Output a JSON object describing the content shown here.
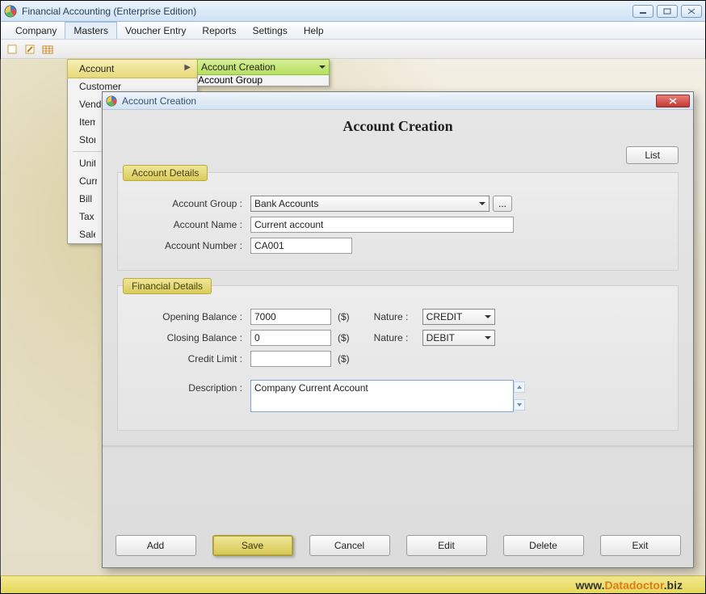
{
  "window": {
    "title": "Financial Accounting (Enterprise Edition)"
  },
  "menubar": {
    "items": [
      "Company",
      "Masters",
      "Voucher Entry",
      "Reports",
      "Settings",
      "Help"
    ],
    "active_index": 1
  },
  "masters_menu": {
    "items": [
      "Account",
      "Customer",
      "Vendor",
      "Item",
      "Store",
      "Unit",
      "Currency",
      "Bill Sundry",
      "Tax",
      "Salesman"
    ],
    "highlight_index": 0
  },
  "account_submenu": {
    "items": [
      "Account Creation",
      "Account Group"
    ],
    "selected_index": 0
  },
  "dialog": {
    "title": "Account Creation",
    "header": "Account Creation",
    "list_button": "List",
    "groups": {
      "account": {
        "legend": "Account Details",
        "group_label": "Account Group :",
        "group_value": "Bank Accounts",
        "name_label": "Account Name :",
        "name_value": "Current account",
        "number_label": "Account Number :",
        "number_value": "CA001"
      },
      "financial": {
        "legend": "Financial Details",
        "opening_label": "Opening Balance :",
        "opening_value": "7000",
        "closing_label": "Closing Balance :",
        "closing_value": "0",
        "credit_limit_label": "Credit Limit :",
        "credit_limit_value": "",
        "currency_suffix": "($)",
        "nature_label": "Nature :",
        "nature1_value": "CREDIT",
        "nature2_value": "DEBIT",
        "description_label": "Description :",
        "description_value": "Company Current Account"
      }
    },
    "buttons": {
      "add": "Add",
      "save": "Save",
      "cancel": "Cancel",
      "edit": "Edit",
      "delete": "Delete",
      "exit": "Exit"
    },
    "ellipsis": "..."
  },
  "footer": {
    "prefix": "www.",
    "brand": "Datadoctor",
    "suffix": ".biz"
  }
}
